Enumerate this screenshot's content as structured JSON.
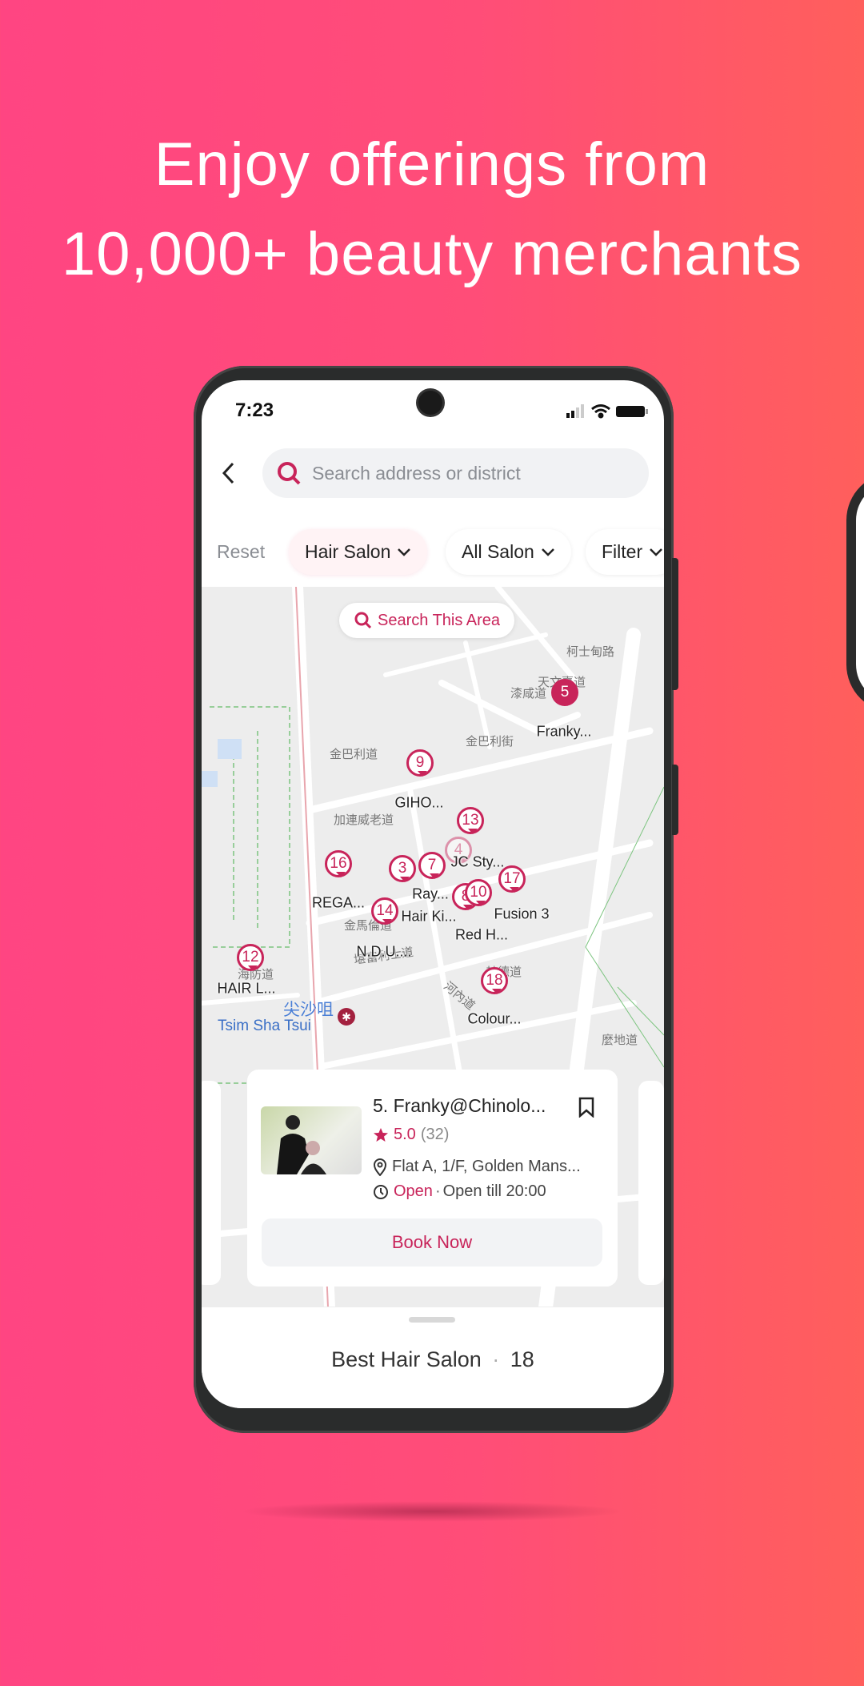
{
  "headline": {
    "line1": "Enjoy offerings from",
    "line2": "10,000+ beauty merchants"
  },
  "colors": {
    "accent": "#c8245a",
    "bg_left": "#ff4582",
    "bg_right": "#ff5f5c"
  },
  "status_bar": {
    "time": "7:23",
    "icons": [
      "signal-icon",
      "wifi-icon",
      "battery-icon"
    ]
  },
  "search": {
    "placeholder": "Search address or district",
    "icon": "search-icon"
  },
  "filters": {
    "reset": "Reset",
    "chips": [
      "Hair Salon",
      "All Salon",
      "Filter"
    ]
  },
  "map": {
    "search_area": "Search This Area",
    "markers": [
      {
        "num": "5",
        "label": "Franky..."
      },
      {
        "num": "9",
        "label": "GIHO..."
      },
      {
        "num": "13",
        "label": "JC Sty..."
      },
      {
        "num": "4",
        "label": ""
      },
      {
        "num": "16",
        "label": "REGA..."
      },
      {
        "num": "3",
        "label": "Hair Ki..."
      },
      {
        "num": "7",
        "label": "Ray..."
      },
      {
        "num": "8",
        "label": "Red H..."
      },
      {
        "num": "10",
        "label": ""
      },
      {
        "num": "17",
        "label": "Fusion 3"
      },
      {
        "num": "14",
        "label": "N.D.U...."
      },
      {
        "num": "12",
        "label": "HAIR L..."
      },
      {
        "num": "18",
        "label": "Colour..."
      }
    ],
    "place_zh": "尖沙咀",
    "place_en": "Tsim Sha Tsui",
    "roads": [
      "金巴利道",
      "金巴利街",
      "加連威老道",
      "天文臺道",
      "金馬倫道",
      "河內道",
      "赫德道",
      "海防道",
      "漆咸道",
      "柯士甸路",
      "麼地道",
      "堪富利士道"
    ]
  },
  "card": {
    "title": "5. Franky@Chinolo...",
    "rating": "5.0",
    "reviews": "(32)",
    "address": "Flat A, 1/F, Golden Mans...",
    "status": "Open",
    "sep": "·",
    "hours": "Open till 20:00",
    "book": "Book Now"
  },
  "sheet": {
    "title": "Best Hair Salon",
    "sep": "·",
    "count": "18"
  }
}
